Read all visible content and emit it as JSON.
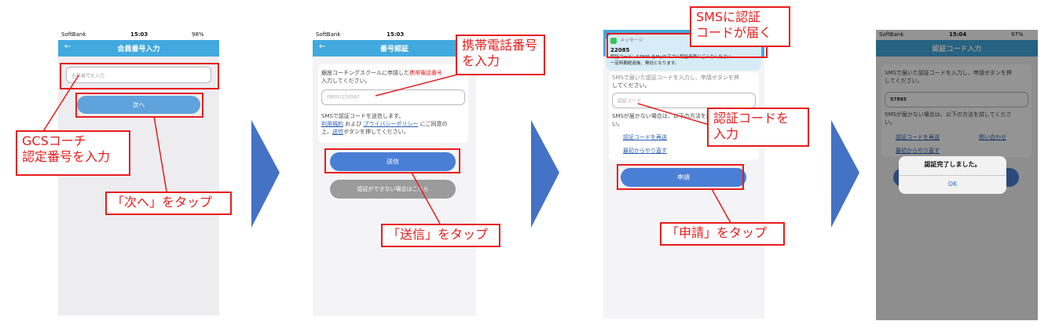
{
  "status": {
    "carrier": "SoftBank",
    "screen1_time": "15:03",
    "screen2_time": "15:03",
    "screen4_time": "15:04",
    "screen1_battery": "98%",
    "screen4_battery": "97%"
  },
  "screen1": {
    "title": "会員番号入力",
    "back": "←",
    "input_placeholder": "会員番号を入力",
    "next_button": "次へ"
  },
  "screen2": {
    "title": "番号認証",
    "back": "←",
    "desc_line1_prefix": "銀座コーチングスクールに申請した",
    "desc_line1_red": "携帯電話番号",
    "desc_line2": "入力してください。",
    "input_placeholder": "08001234567",
    "sms_line": "SMSで認証コードを送信します。",
    "terms_link": "利用規約",
    "and_text": "および",
    "privacy_link": "プライバシーポリシー",
    "agree_text": "にご同意の",
    "agree_line2_prefix": "上、",
    "send_link": "送信",
    "agree_line2_suffix": "ボタンを押してください。",
    "send_button": "送信",
    "fallback_button": "認証ができない場合はこちら"
  },
  "screen3": {
    "notif_app": "メッセージ",
    "notif_sender": "22085",
    "notif_line1": "認証コード：57895 をMyIDアプリ認証画面にご入力ください。",
    "notif_line2": "一定時間経過後、無効となります。",
    "desc_partial": "SMSで届いた認証コードを入力し、申請ボタンを押",
    "desc_line2": "してください。",
    "input_placeholder": "認証コード",
    "notice_line1": "SMSが届かない場合は、以下の方法を試してくださ",
    "notice_line2": "い。",
    "resend_link": "認証コードを再送",
    "restart_link": "最初からやり直す",
    "apply_button": "申請"
  },
  "screen4": {
    "title": "認証コード入力",
    "desc_line1": "SMSで届いた認証コードを入力し、申請ボタンを押",
    "desc_line2": "してください。",
    "input_value": "57895",
    "notice_line1": "SMSが届かない場合は、以下の方法を試してくださ",
    "notice_line2": "い。",
    "resend_link": "認証コードを再送",
    "contact_link": "問い合わせ",
    "restart_link": "最初からやり直す",
    "alert_title": "認証完了しました。",
    "alert_ok": "OK"
  },
  "callouts": {
    "gcs_line1": "GCSコーチ",
    "gcs_line2": "認定番号を入力",
    "tap_next": "「次へ」をタップ",
    "phone_line1": "携帯電話番号",
    "phone_line2": "を入力",
    "tap_send": "「送信」をタップ",
    "sms_line1": "SMSに認証",
    "sms_line2": "コードが届く",
    "code_line1": "認証コードを",
    "code_line2": "入力",
    "tap_apply": "「申請」をタップ"
  },
  "colors": {
    "navbar": "#42a9de",
    "arrow": "#4472c4",
    "callout": "#e81c1c",
    "primary_button": "#4a7fd6"
  }
}
